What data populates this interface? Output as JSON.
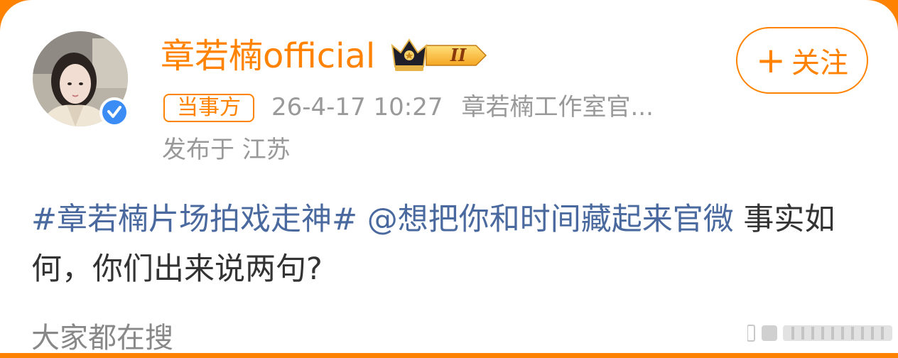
{
  "user": {
    "name": "章若楠official",
    "party_tag": "当事方",
    "timestamp": "26-4-17 10:27",
    "source": "章若楠工作室官...",
    "location": "发布于 江苏",
    "vip_level": "II",
    "verified_icon": "verified-badge-icon"
  },
  "follow": {
    "plus": "+",
    "label": "关注"
  },
  "post": {
    "topic": "#章若楠片场拍戏走神#",
    "mention": "@想把你和时间藏起来官微",
    "text": " 事实如何，你们出来说两句?"
  },
  "hot_search": {
    "title": "大家都在搜"
  },
  "colors": {
    "accent": "#ff8200",
    "link": "#4a6a9f",
    "meta": "#999999",
    "text": "#333333"
  }
}
